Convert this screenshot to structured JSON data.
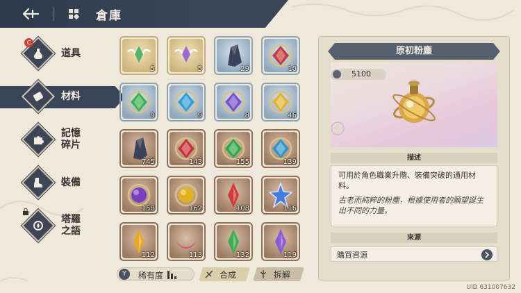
{
  "header": {
    "title": "倉庫"
  },
  "sidebar": {
    "items": [
      {
        "label": "道具",
        "icon": "potion-icon",
        "active": false
      },
      {
        "label": "材料",
        "icon": "scroll-icon",
        "active": true
      },
      {
        "label": "記憶\n碎片",
        "icon": "puzzle-icon",
        "active": false
      },
      {
        "label": "裝備",
        "icon": "boot-icon",
        "active": false
      },
      {
        "label": "塔羅\n之語",
        "icon": "tarot-icon",
        "active": false
      }
    ]
  },
  "grid": {
    "items": [
      {
        "count": "5",
        "rarity": "gold",
        "icon": "green-winged-crystal-icon",
        "color": "#4fb56a"
      },
      {
        "count": "5",
        "rarity": "gold",
        "icon": "purple-winged-star-icon",
        "color": "#9b6ad0"
      },
      {
        "count": "29",
        "rarity": "blue",
        "icon": "dark-crystal-icon",
        "color": "#39435a"
      },
      {
        "count": "10",
        "rarity": "blue",
        "icon": "red-crest-icon",
        "color": "#c43a3a"
      },
      {
        "count": "9",
        "rarity": "blue",
        "icon": "green-gem-icon",
        "color": "#3db24d"
      },
      {
        "count": "9",
        "rarity": "blue",
        "icon": "blue-gem-icon",
        "color": "#2f9fd6"
      },
      {
        "count": "8",
        "rarity": "blue",
        "icon": "purple-gem-icon",
        "color": "#7b4fc9"
      },
      {
        "count": "46",
        "rarity": "blue",
        "icon": "gold-gem-icon",
        "color": "#e0b32c"
      },
      {
        "count": "745",
        "rarity": "brown",
        "icon": "dark-crystal-icon",
        "color": "#3b4358"
      },
      {
        "count": "143",
        "rarity": "brown",
        "icon": "red-gem-icon",
        "color": "#c93131"
      },
      {
        "count": "155",
        "rarity": "brown",
        "icon": "green-gem-icon",
        "color": "#2fa84a"
      },
      {
        "count": "139",
        "rarity": "brown",
        "icon": "blue-gem-icon",
        "color": "#2c96c9"
      },
      {
        "count": "158",
        "rarity": "brown",
        "icon": "purple-orb-icon",
        "color": "#7a3fbf"
      },
      {
        "count": "162",
        "rarity": "brown",
        "icon": "gold-orb-icon",
        "color": "#e3b11f"
      },
      {
        "count": "108",
        "rarity": "brown",
        "icon": "red-shard-icon",
        "color": "#d23b3b"
      },
      {
        "count": "116",
        "rarity": "brown",
        "icon": "blue-star-icon",
        "color": "#3d7fe0"
      },
      {
        "count": "112",
        "rarity": "brown",
        "icon": "gold-shard-icon",
        "color": "#e6a825"
      },
      {
        "count": "113",
        "rarity": "brown",
        "icon": "pink-crescent-icon",
        "color": "#e0547a"
      },
      {
        "count": "132",
        "rarity": "brown",
        "icon": "green-shard-icon",
        "color": "#3fae52"
      },
      {
        "count": "119",
        "rarity": "brown",
        "icon": "violet-shard-icon",
        "color": "#8a5ad6"
      }
    ]
  },
  "bottom": {
    "rarity_label": "稀有度",
    "compose_label": "合成",
    "dismantle_label": "拆解"
  },
  "detail": {
    "title": "原初粉塵",
    "count": "5100",
    "desc_header": "描述",
    "description": "可用於角色職業升階、裝備突破的通用材料。",
    "lore": "古老而純粹的粉塵，根據使用者的願望誕生出不同的力量。",
    "source_header": "來源",
    "source_button": "購買資源"
  },
  "uid": "UID 631007632",
  "colors": {
    "header_bg": "#3a4558",
    "panel_bg": "#e6decd",
    "accent": "#4b5262"
  }
}
